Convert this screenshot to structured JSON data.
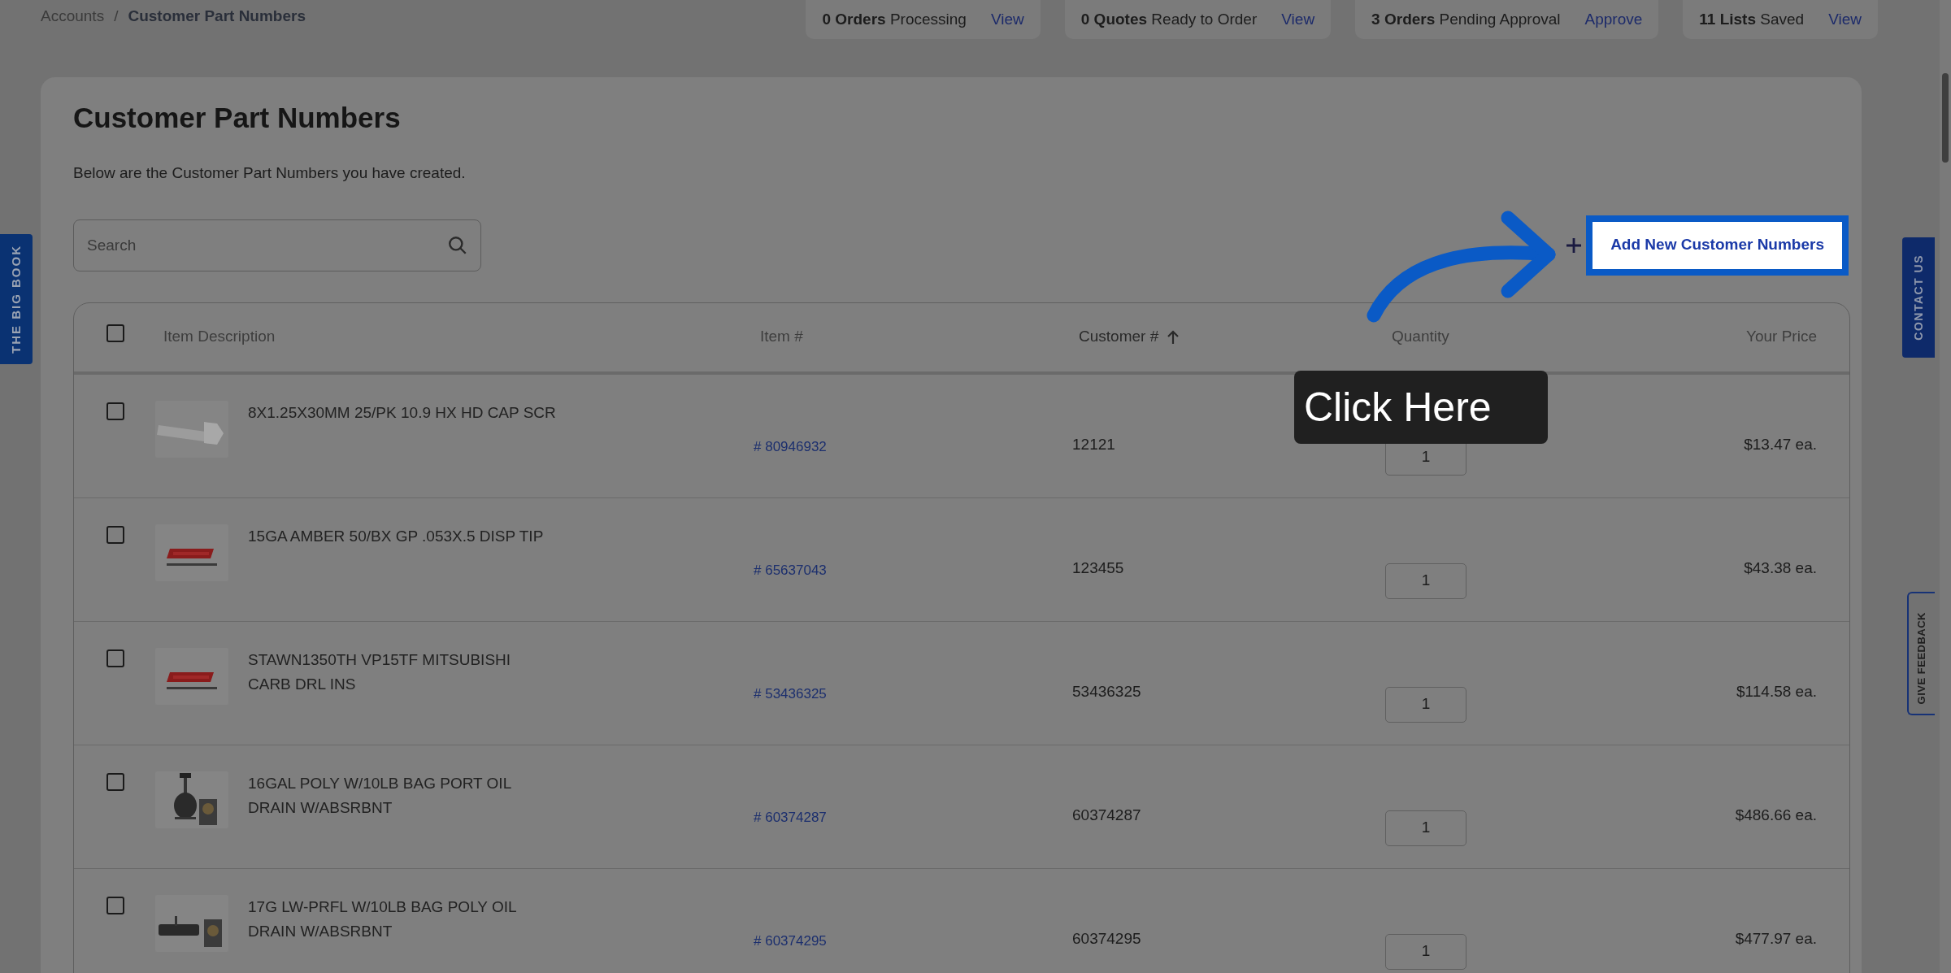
{
  "breadcrumb": {
    "items": [
      "Accounts",
      "Customer Part Numbers"
    ],
    "separator": "/"
  },
  "stats": [
    {
      "count": "0 Orders",
      "label": "Processing",
      "action": "View"
    },
    {
      "count": "0 Quotes",
      "label": "Ready to Order",
      "action": "View"
    },
    {
      "count": "3 Orders",
      "label": "Pending Approval",
      "action": "Approve"
    },
    {
      "count": "11 Lists",
      "label": "Saved",
      "action": "View"
    }
  ],
  "page": {
    "title": "Customer Part Numbers",
    "subtitle": "Below are the Customer Part Numbers you have created."
  },
  "search": {
    "placeholder": "Search"
  },
  "add_button": {
    "label": "Add New Customer Numbers",
    "highlighted": true
  },
  "table": {
    "select_all_checked": false,
    "columns": [
      {
        "label": "Item Description",
        "sorted": false
      },
      {
        "label": "Item #",
        "sorted": false
      },
      {
        "label": "Customer #",
        "sorted": true
      },
      {
        "label": "Quantity",
        "sorted": false
      },
      {
        "label": "Your Price",
        "sorted": false
      }
    ],
    "rows": [
      {
        "checked": false,
        "description": "8X1.25X30MM 25/PK 10.9 HX HD CAP SCR",
        "item": "# 80946932",
        "customer": "12121",
        "quantity": "1",
        "price": "$13.47 ea."
      },
      {
        "checked": false,
        "description": "15GA AMBER 50/BX GP .053X.5 DISP TIP",
        "item": "# 65637043",
        "customer": "123455",
        "quantity": "1",
        "price": "$43.38 ea."
      },
      {
        "checked": false,
        "description": "STAWN1350TH VP15TF MITSUBISHI CARB DRL INS",
        "item": "# 53436325",
        "customer": "53436325",
        "quantity": "1",
        "price": "$114.58 ea."
      },
      {
        "checked": false,
        "description": "16GAL POLY W/10LB BAG PORT OIL DRAIN W/ABSRBNT",
        "item": "# 60374287",
        "customer": "60374287",
        "quantity": "1",
        "price": "$486.66 ea."
      },
      {
        "checked": false,
        "description": "17G LW-PRFL W/10LB BAG POLY OIL DRAIN W/ABSRBNT",
        "item": "# 60374295",
        "customer": "60374295",
        "quantity": "1",
        "price": "$477.97 ea."
      }
    ]
  },
  "side_tabs": {
    "left": "THE BIG BOOK",
    "contact": "CONTACT US",
    "feedback": "GIVE FEEDBACK"
  },
  "tooltip": {
    "text": "Click Here"
  }
}
